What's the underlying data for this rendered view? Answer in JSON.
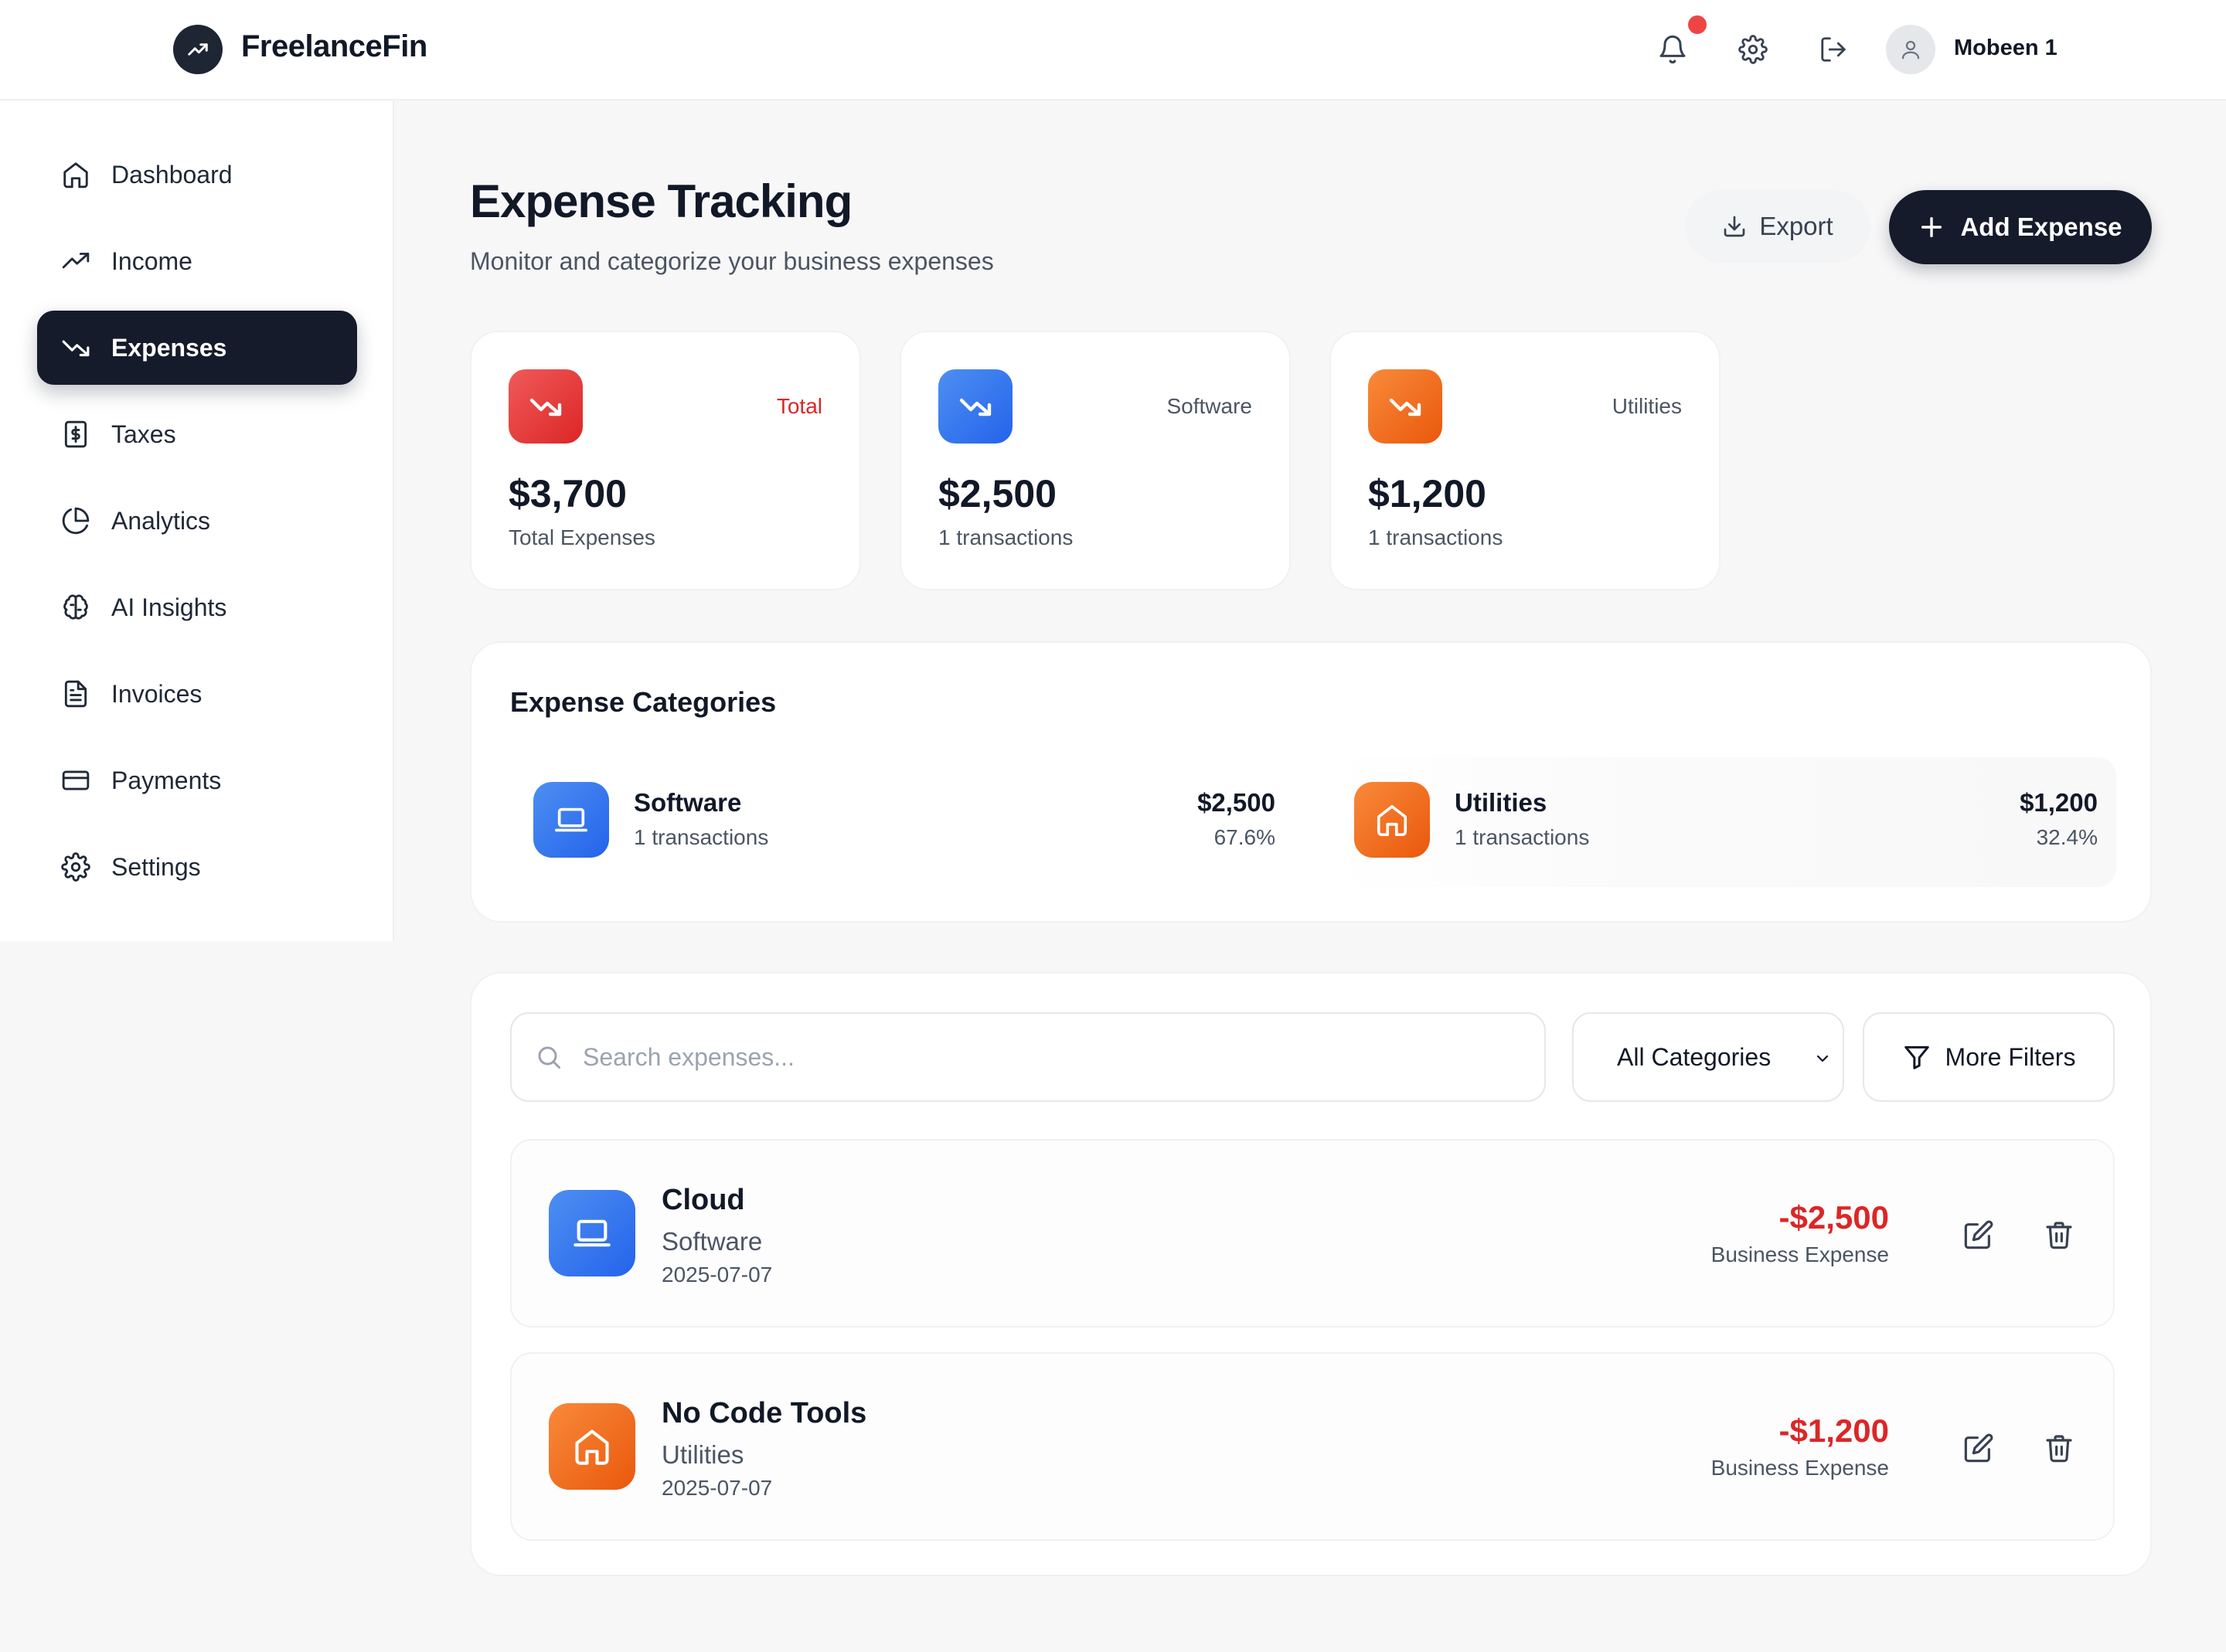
{
  "header": {
    "brand": "FreelanceFin",
    "username": "Mobeen 1",
    "icons": [
      "trending-up-icon",
      "bell-icon",
      "gear-icon",
      "logout-icon",
      "user-icon"
    ]
  },
  "sidebar": {
    "items": [
      {
        "label": "Dashboard",
        "icon": "home-icon"
      },
      {
        "label": "Income",
        "icon": "trending-up-icon"
      },
      {
        "label": "Expenses",
        "icon": "trending-down-icon",
        "active": true
      },
      {
        "label": "Taxes",
        "icon": "dollar-doc-icon"
      },
      {
        "label": "Analytics",
        "icon": "pie-chart-icon"
      },
      {
        "label": "AI Insights",
        "icon": "brain-icon"
      },
      {
        "label": "Invoices",
        "icon": "document-icon"
      },
      {
        "label": "Payments",
        "icon": "credit-card-icon"
      },
      {
        "label": "Settings",
        "icon": "gear-icon"
      }
    ]
  },
  "page": {
    "title": "Expense Tracking",
    "subtitle": "Monitor and categorize your business expenses",
    "export_label": "Export",
    "add_label": "Add Expense"
  },
  "stats": [
    {
      "tag": "Total",
      "value": "$3,700",
      "sub": "Total Expenses",
      "color": "#dc2626"
    },
    {
      "tag": "Software",
      "value": "$2,500",
      "sub": "1 transactions",
      "color": "#2563eb"
    },
    {
      "tag": "Utilities",
      "value": "$1,200",
      "sub": "1 transactions",
      "color": "#ea580c"
    }
  ],
  "categories": {
    "title": "Expense Categories",
    "items": [
      {
        "name": "Software",
        "count": "1 transactions",
        "amount": "$2,500",
        "percent": "67.6%",
        "icon": "laptop-icon"
      },
      {
        "name": "Utilities",
        "count": "1 transactions",
        "amount": "$1,200",
        "percent": "32.4%",
        "icon": "home-icon"
      }
    ]
  },
  "filters": {
    "search_placeholder": "Search expenses...",
    "category_selected": "All Categories",
    "more_filters_label": "More Filters"
  },
  "expenses": [
    {
      "name": "Cloud",
      "category": "Software",
      "date": "2025-07-07",
      "amount": "-$2,500",
      "type": "Business Expense",
      "icon": "laptop-icon"
    },
    {
      "name": "No Code Tools",
      "category": "Utilities",
      "date": "2025-07-07",
      "amount": "-$1,200",
      "type": "Business Expense",
      "icon": "home-icon"
    }
  ],
  "colors": {
    "primary_dark": "#151b2b",
    "negative": "#dc2626",
    "software_blue": "#2563eb",
    "utilities_orange": "#ea580c",
    "notification_red": "#ef4444"
  }
}
